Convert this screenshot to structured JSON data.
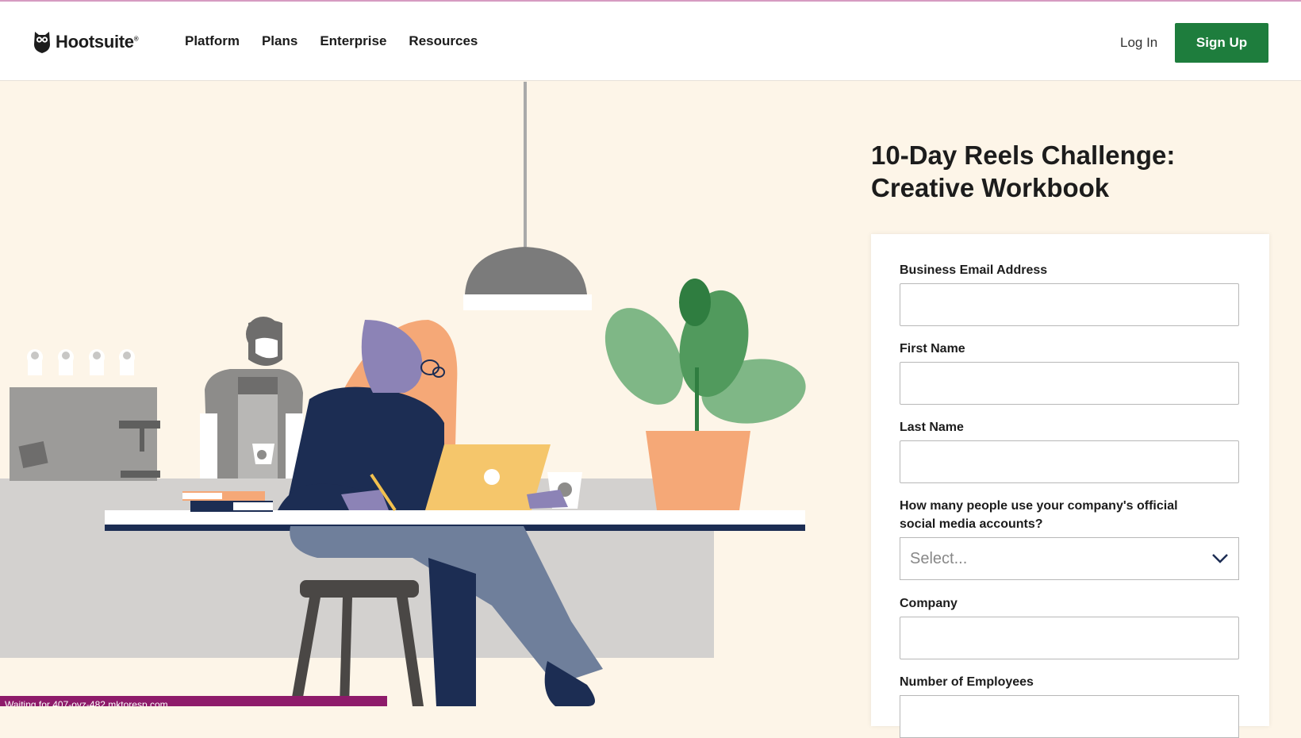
{
  "header": {
    "logo_text": "Hootsuite",
    "logo_mark": "®",
    "nav": [
      {
        "label": "Platform"
      },
      {
        "label": "Plans"
      },
      {
        "label": "Enterprise"
      },
      {
        "label": "Resources"
      }
    ],
    "login_label": "Log In",
    "signup_label": "Sign Up"
  },
  "hero": {
    "title": "10-Day Reels Challenge: Creative Workbook"
  },
  "form": {
    "email_label": "Business Email Address",
    "email_value": "",
    "first_name_label": "First Name",
    "first_name_value": "",
    "last_name_label": "Last Name",
    "last_name_value": "",
    "accounts_label": "How many people use your company's official social media accounts?",
    "accounts_selected": "Select...",
    "company_label": "Company",
    "company_value": "",
    "employees_label": "Number of Employees"
  },
  "status_bar": {
    "text": "Waiting for 407-ovz-482.mktoresp.com..."
  },
  "colors": {
    "brand_green": "#1e7d3d",
    "hero_background": "#fdf5e8",
    "status_bar": "#8e1b6a"
  },
  "icons": {
    "logo": "owl-icon",
    "select_arrow": "chevron-down-icon"
  }
}
